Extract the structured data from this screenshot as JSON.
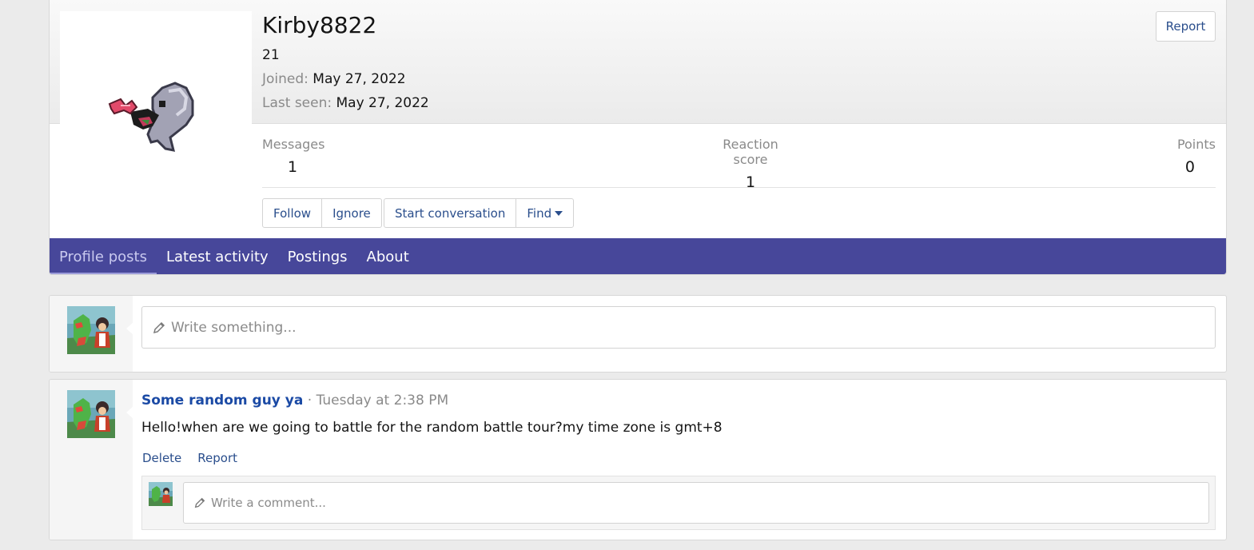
{
  "profile": {
    "username": "Kirby8822",
    "user_title": "21",
    "joined_label": "Joined:",
    "joined_value": "May 27, 2022",
    "last_seen_label": "Last seen:",
    "last_seen_value": "May 27, 2022",
    "report_label": "Report",
    "stats": {
      "messages_label": "Messages",
      "messages_value": "1",
      "reaction_label": "Reaction score",
      "reaction_value": "1",
      "points_label": "Points",
      "points_value": "0"
    },
    "buttons": {
      "follow": "Follow",
      "ignore": "Ignore",
      "start_conversation": "Start conversation",
      "find": "Find"
    }
  },
  "tabs": [
    {
      "label": "Profile posts",
      "active": true
    },
    {
      "label": "Latest activity",
      "active": false
    },
    {
      "label": "Postings",
      "active": false
    },
    {
      "label": "About",
      "active": false
    }
  ],
  "compose": {
    "placeholder": "Write something..."
  },
  "post": {
    "author": "Some random guy ya",
    "separator": " · ",
    "time": "Tuesday at 2:38 PM",
    "body": "Hello!when are we going to battle for the random battle tour?my time zone is gmt+8",
    "delete_label": "Delete",
    "report_label": "Report",
    "comment_placeholder": "Write a comment..."
  },
  "colors": {
    "accent": "#47479a",
    "link": "#2a4e8c",
    "author": "#1b4aa5"
  }
}
